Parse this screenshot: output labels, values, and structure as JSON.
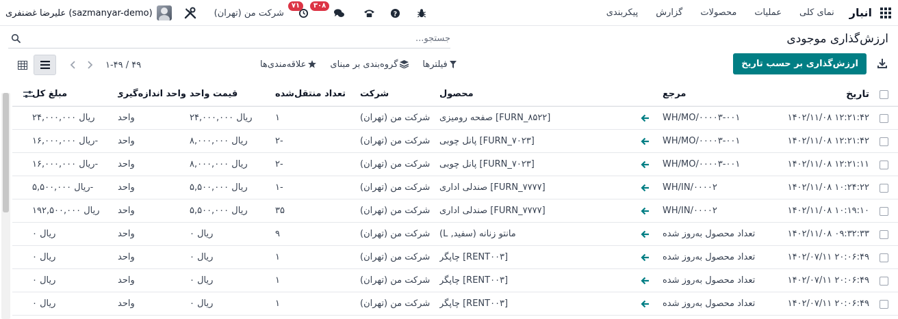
{
  "navbar": {
    "brand": "انبار",
    "menu": [
      "نمای کلی",
      "عملیات",
      "محصولات",
      "گزارش",
      "پیکربندی"
    ],
    "company": "شرکت من (تهران)",
    "user": "علیرضا غضنفری (sazmanyar-demo)",
    "messages_badge": "۳۰۸",
    "activities_badge": "۷۱"
  },
  "page": {
    "title": "ارزش‌گذاری موجودی",
    "primary_button": "ارزش‌گذاری بر حسب تاریخ"
  },
  "search": {
    "placeholder": "جستجو..."
  },
  "filters": {
    "filters_label": "فیلترها",
    "group_by_label": "گروه‌بندی بر مبنای",
    "favorites_label": "علاقه‌مندی‌ها"
  },
  "pager": {
    "value": "۱-۴۹ / ۴۹"
  },
  "table": {
    "columns": {
      "date": "تاریخ",
      "reference": "مرجع",
      "product": "محصول",
      "company": "شرکت",
      "quantity": "تعداد منتقل‌شده",
      "unit_price": "قیمت واحد",
      "uom": "واحد اندازه‌گیری",
      "total": "مبلغ کل"
    },
    "rows": [
      {
        "date": "۱۴۰۲/۱۱/۰۸ ۱۲:۲۱:۴۲",
        "reference": "WH/MO/۰۰۰۰۳-۰۰۱",
        "product": "[FURN_۸۵۲۲] صفحه رومیزی",
        "company": "شرکت من (تهران)",
        "quantity": "۱",
        "unit_price": "ریال ۲۴,۰۰۰,۰۰۰",
        "uom": "واحد",
        "total": "ریال ۲۴,۰۰۰,۰۰۰"
      },
      {
        "date": "۱۴۰۲/۱۱/۰۸ ۱۲:۲۱:۴۲",
        "reference": "WH/MO/۰۰۰۰۳-۰۰۱",
        "product": "[FURN_۷۰۲۳] پانل چوبی",
        "company": "شرکت من (تهران)",
        "quantity": "-۲",
        "unit_price": "ریال ۸,۰۰۰,۰۰۰",
        "uom": "واحد",
        "total": "-ریال ۱۶,۰۰۰,۰۰۰"
      },
      {
        "date": "۱۴۰۲/۱۱/۰۸ ۱۲:۲۱:۱۱",
        "reference": "WH/MO/۰۰۰۰۳-۰۰۱",
        "product": "[FURN_۷۰۲۳] پانل چوبی",
        "company": "شرکت من (تهران)",
        "quantity": "-۲",
        "unit_price": "ریال ۸,۰۰۰,۰۰۰",
        "uom": "واحد",
        "total": "-ریال ۱۶,۰۰۰,۰۰۰"
      },
      {
        "date": "۱۴۰۲/۱۱/۰۸ ۱۰:۲۴:۲۲",
        "reference": "WH/IN/۰۰۰۰۲",
        "product": "[FURN_۷۷۷۷] صندلی اداری",
        "company": "شرکت من (تهران)",
        "quantity": "-۱",
        "unit_price": "ریال ۵,۵۰۰,۰۰۰",
        "uom": "واحد",
        "total": "-ریال ۵,۵۰۰,۰۰۰"
      },
      {
        "date": "۱۴۰۲/۱۱/۰۸ ۱۰:۱۹:۱۰",
        "reference": "WH/IN/۰۰۰۰۲",
        "product": "[FURN_۷۷۷۷] صندلی اداری",
        "company": "شرکت من (تهران)",
        "quantity": "۳۵",
        "unit_price": "ریال ۵,۵۰۰,۰۰۰",
        "uom": "واحد",
        "total": "ریال ۱۹۲,۵۰۰,۰۰۰"
      },
      {
        "date": "۱۴۰۲/۱۱/۰۸ ۰۹:۳۲:۳۳",
        "reference": "تعداد محصول به‌روز شده",
        "product": "مانتو زنانه (سفید, L)",
        "company": "شرکت من (تهران)",
        "quantity": "۹",
        "unit_price": "ریال ۰",
        "uom": "واحد",
        "total": "ریال ۰"
      },
      {
        "date": "۱۴۰۲/۰۷/۱۱ ۲۰:۰۶:۴۹",
        "reference": "تعداد محصول به‌روز شده",
        "product": "[RENT۰۰۳] چاپگر",
        "company": "شرکت من (تهران)",
        "quantity": "۱",
        "unit_price": "ریال ۰",
        "uom": "واحد",
        "total": "ریال ۰"
      },
      {
        "date": "۱۴۰۲/۰۷/۱۱ ۲۰:۰۶:۴۹",
        "reference": "تعداد محصول به‌روز شده",
        "product": "[RENT۰۰۳] چاپگر",
        "company": "شرکت من (تهران)",
        "quantity": "۱",
        "unit_price": "ریال ۰",
        "uom": "واحد",
        "total": "ریال ۰"
      },
      {
        "date": "۱۴۰۲/۰۷/۱۱ ۲۰:۰۶:۴۹",
        "reference": "تعداد محصول به‌روز شده",
        "product": "[RENT۰۰۳] چاپگر",
        "company": "شرکت من (تهران)",
        "quantity": "۱",
        "unit_price": "ریال ۰",
        "uom": "واحد",
        "total": "ریال ۰"
      }
    ]
  },
  "colors": {
    "primary": "#017e84",
    "badge": "#dc3545",
    "arrow": "#017e84"
  },
  "icons": [
    "apps-icon",
    "tools-icon",
    "activity-clock-icon",
    "chat-icon",
    "phone-icon",
    "help-icon",
    "debug-bug-icon",
    "search-icon",
    "download-icon",
    "filter-icon",
    "layers-icon",
    "star-icon",
    "chevron-left-icon",
    "chevron-right-icon",
    "list-view-icon",
    "grid-view-icon",
    "arrow-left-icon",
    "optional-columns-icon"
  ]
}
